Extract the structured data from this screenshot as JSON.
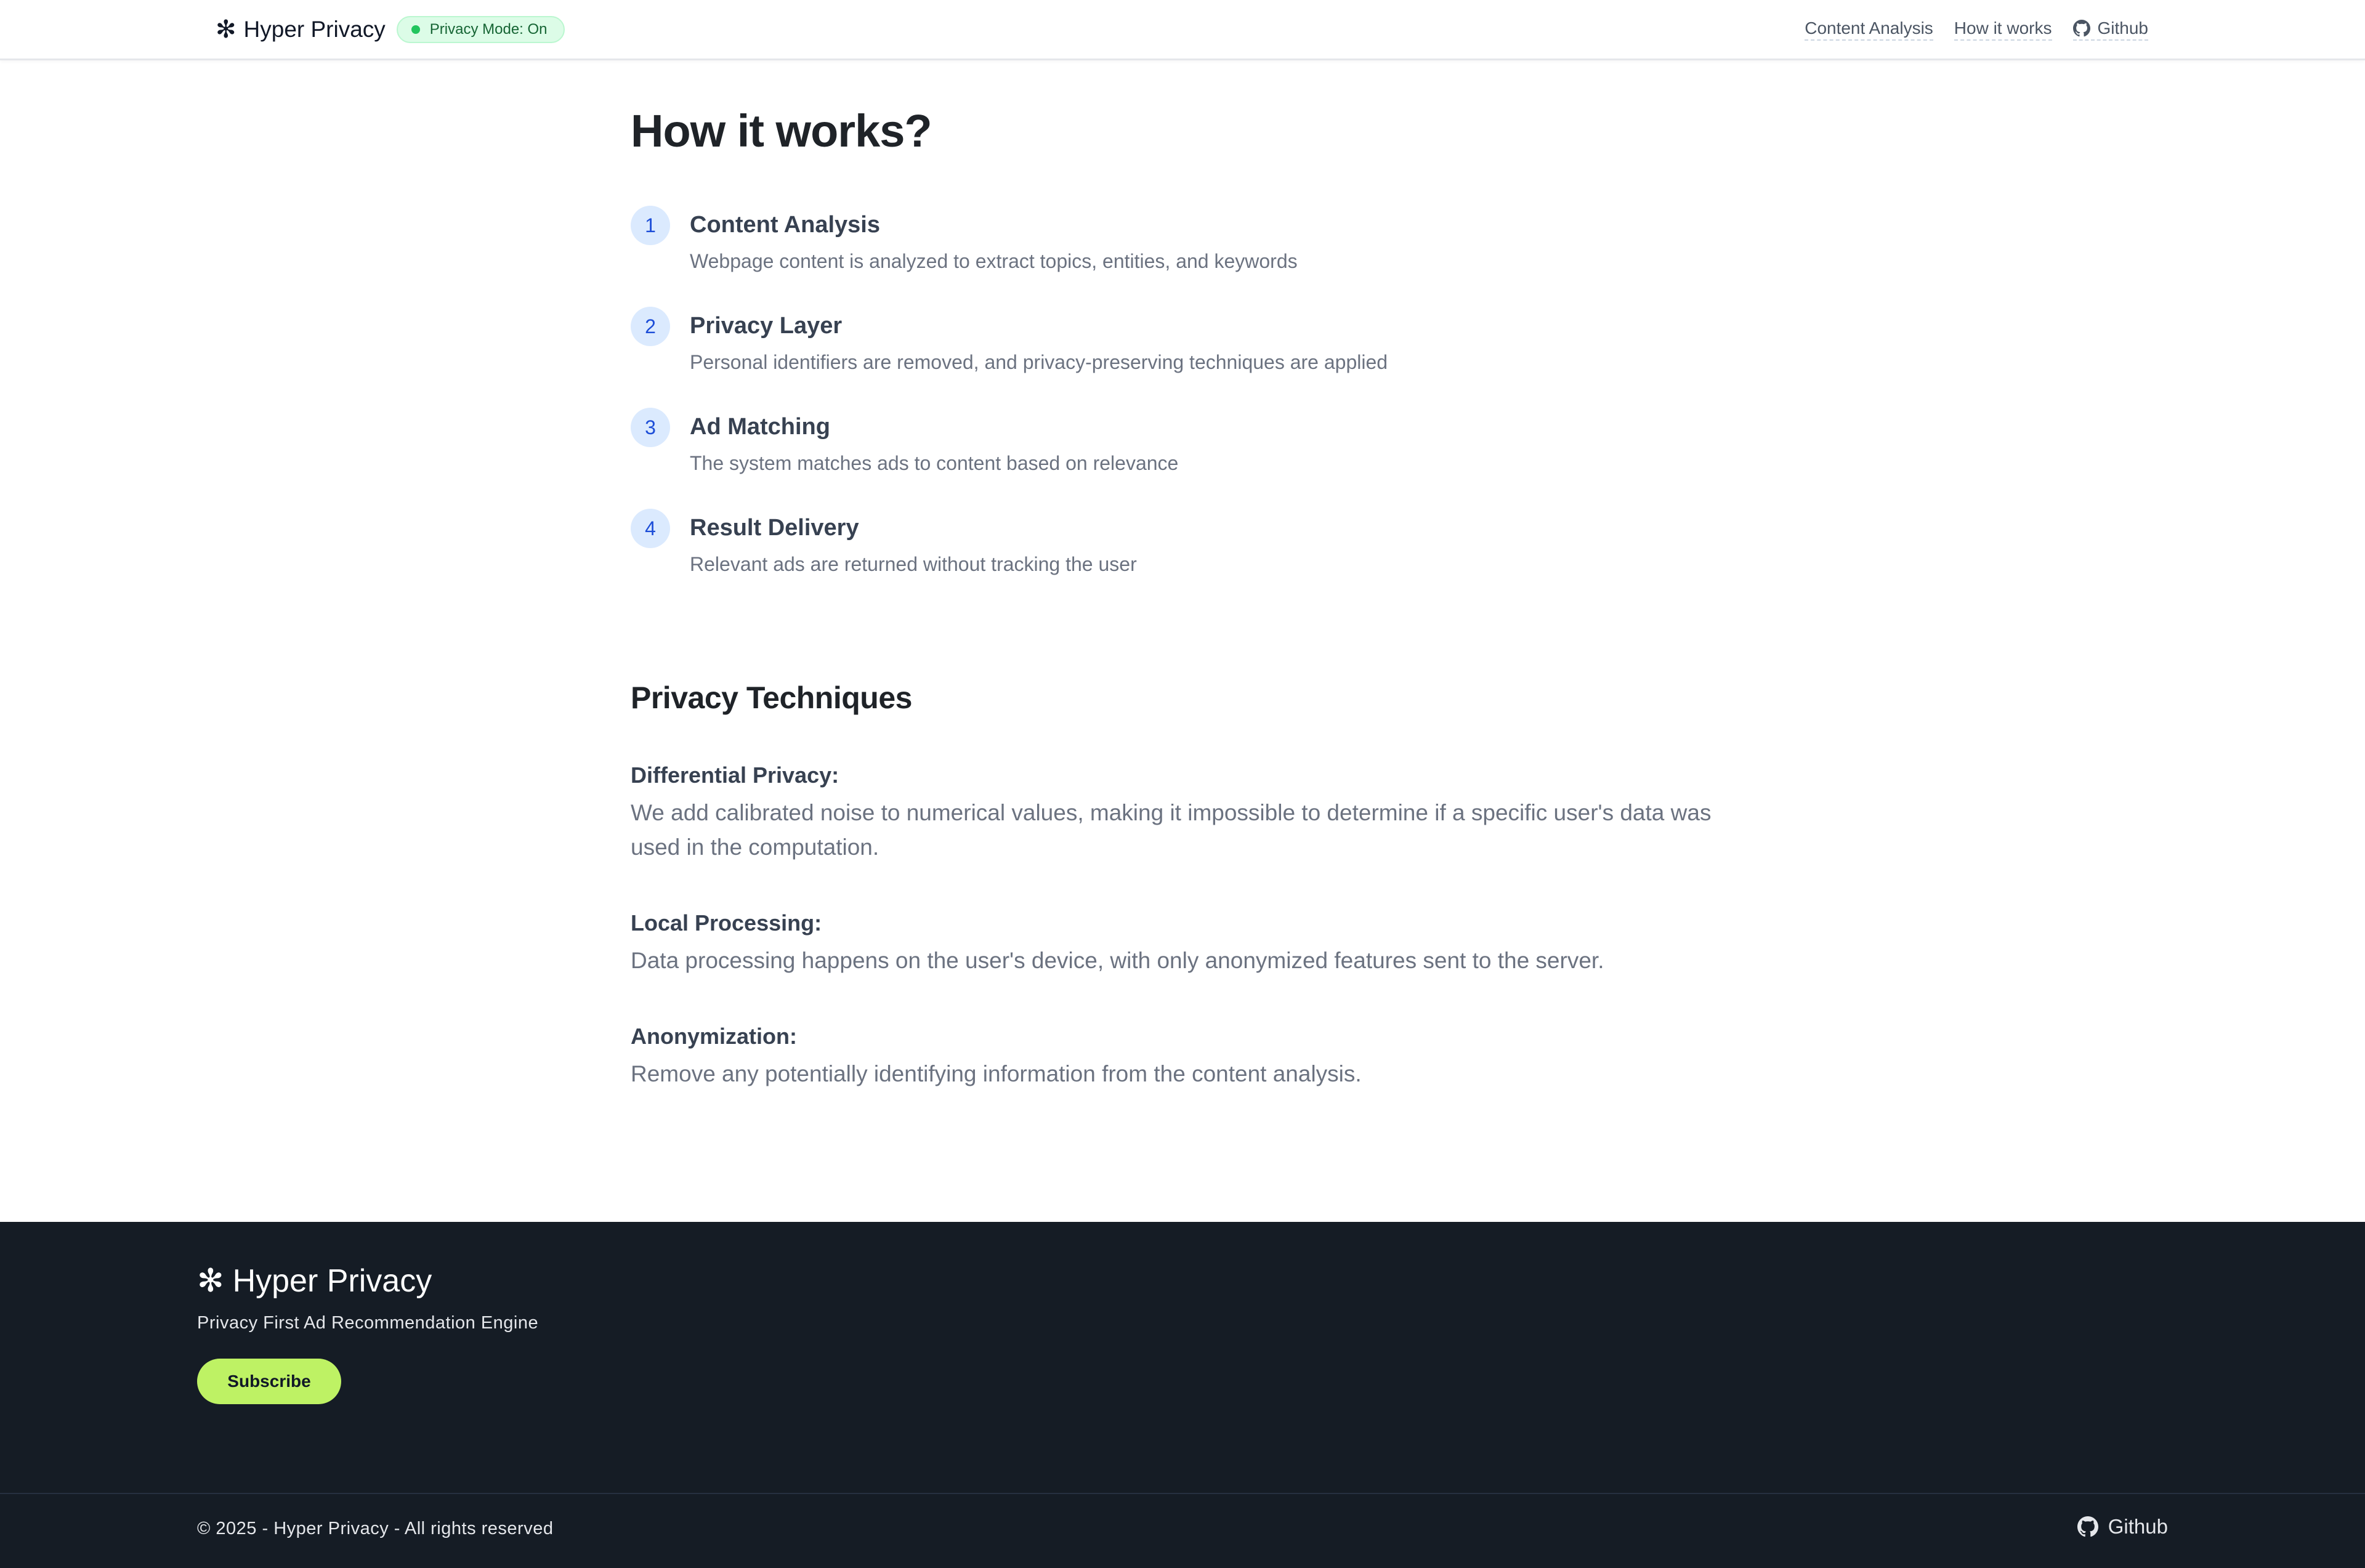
{
  "header": {
    "brand_symbol": "✻",
    "brand_name": "Hyper Privacy",
    "badge_label": "Privacy Mode: On",
    "nav": {
      "content_analysis": "Content Analysis",
      "how_it_works": "How it works",
      "github": "Github"
    }
  },
  "main": {
    "title": "How it works?",
    "steps": [
      {
        "num": "1",
        "title": "Content Analysis",
        "desc": "Webpage content is analyzed to extract topics, entities, and keywords"
      },
      {
        "num": "2",
        "title": "Privacy Layer",
        "desc": "Personal identifiers are removed, and privacy-preserving techniques are applied"
      },
      {
        "num": "3",
        "title": "Ad Matching",
        "desc": "The system matches ads to content based on relevance"
      },
      {
        "num": "4",
        "title": "Result Delivery",
        "desc": "Relevant ads are returned without tracking the user"
      }
    ],
    "techniques_title": "Privacy Techniques",
    "techniques": [
      {
        "label": "Differential Privacy:",
        "desc": "We add calibrated noise to numerical values, making it impossible to determine if a specific user's data was used in the computation."
      },
      {
        "label": "Local Processing:",
        "desc": "Data processing happens on the user's device, with only anonymized features sent to the server."
      },
      {
        "label": "Anonymization:",
        "desc": "Remove any potentially identifying information from the content analysis."
      }
    ]
  },
  "footer": {
    "brand_symbol": "✻",
    "brand_name": "Hyper Privacy",
    "tagline": "Privacy First Ad Recommendation Engine",
    "subscribe_label": "Subscribe",
    "copyright": "© 2025 - Hyper Privacy - All rights reserved",
    "github_label": "Github"
  },
  "colors": {
    "accent_green": "#bef264",
    "badge_green": "#22c55e",
    "step_blue": "#1d4ed8",
    "footer_bg": "#151c25"
  },
  "icons": {
    "brand": "asterisk-icon",
    "github": "github-icon",
    "status": "status-dot-icon"
  }
}
